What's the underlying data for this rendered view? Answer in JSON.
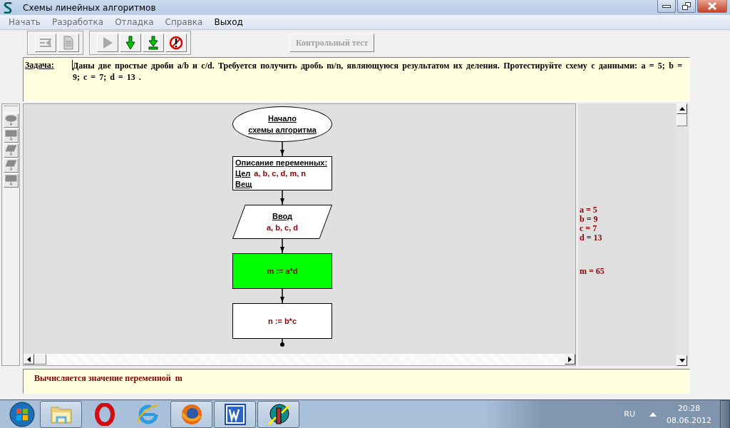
{
  "window": {
    "title": "Схемы линейных алгоритмов"
  },
  "menu": [
    {
      "label": "Начать",
      "disabled": true
    },
    {
      "label": "Разработка",
      "disabled": true
    },
    {
      "label": "Отладка",
      "disabled": true
    },
    {
      "label": "Справка",
      "disabled": true
    },
    {
      "label": "Выход",
      "disabled": false
    }
  ],
  "toolbar": {
    "groups": [
      [
        {
          "kind": "edit",
          "disabled": true
        },
        {
          "kind": "document",
          "disabled": true
        }
      ],
      [
        {
          "kind": "run",
          "disabled": true
        },
        {
          "kind": "step",
          "disabled": false
        },
        {
          "kind": "step-to",
          "disabled": false
        },
        {
          "kind": "stop",
          "disabled": false
        }
      ]
    ],
    "test_button": {
      "label": "Контрольный тест",
      "disabled": true
    }
  },
  "task": {
    "label": "Задача:",
    "text": "Даны две простые дроби a/b и c/d. Требуется получить дробь m/n, являющуюся результатом их деления. Протестируйте схему с данными: a = 5; b = 9; c = 7; d = 13 ."
  },
  "palette": [
    {
      "kind": "terminator"
    },
    {
      "kind": "process"
    },
    {
      "kind": "io"
    },
    {
      "kind": "io"
    },
    {
      "kind": "process"
    }
  ],
  "blocks": [
    {
      "kind": "terminator",
      "active": false,
      "text": "Начало\nсхемы алгоритма"
    },
    {
      "kind": "declaration",
      "active": false,
      "title": "Описание переменных:",
      "lines": [
        {
          "type_label": "Цел",
          "vars": "a, b, c, d, m, n"
        },
        {
          "type_label": "Вещ"
        }
      ]
    },
    {
      "kind": "io",
      "active": false,
      "title": "Ввод",
      "vars": "a, b, c, d"
    },
    {
      "kind": "process",
      "active": true,
      "formula": "m := a*d"
    },
    {
      "kind": "process",
      "active": false,
      "formula": "n := b*c"
    }
  ],
  "variables": [
    [
      "a = 5",
      "b = 9",
      "c = 7",
      "d = 13"
    ],
    [
      "m = 65"
    ]
  ],
  "status": "Вычисляется значение переменной  m",
  "taskbar": {
    "apps": [
      {
        "kind": "folder",
        "running": true
      },
      {
        "kind": "opera",
        "running": false
      },
      {
        "kind": "ie",
        "running": false
      },
      {
        "kind": "firefox",
        "running": true
      },
      {
        "kind": "word",
        "running": true
      },
      {
        "kind": "app",
        "running": true
      }
    ],
    "language": "RU",
    "time": "20:28",
    "date": "08.06.2012"
  }
}
